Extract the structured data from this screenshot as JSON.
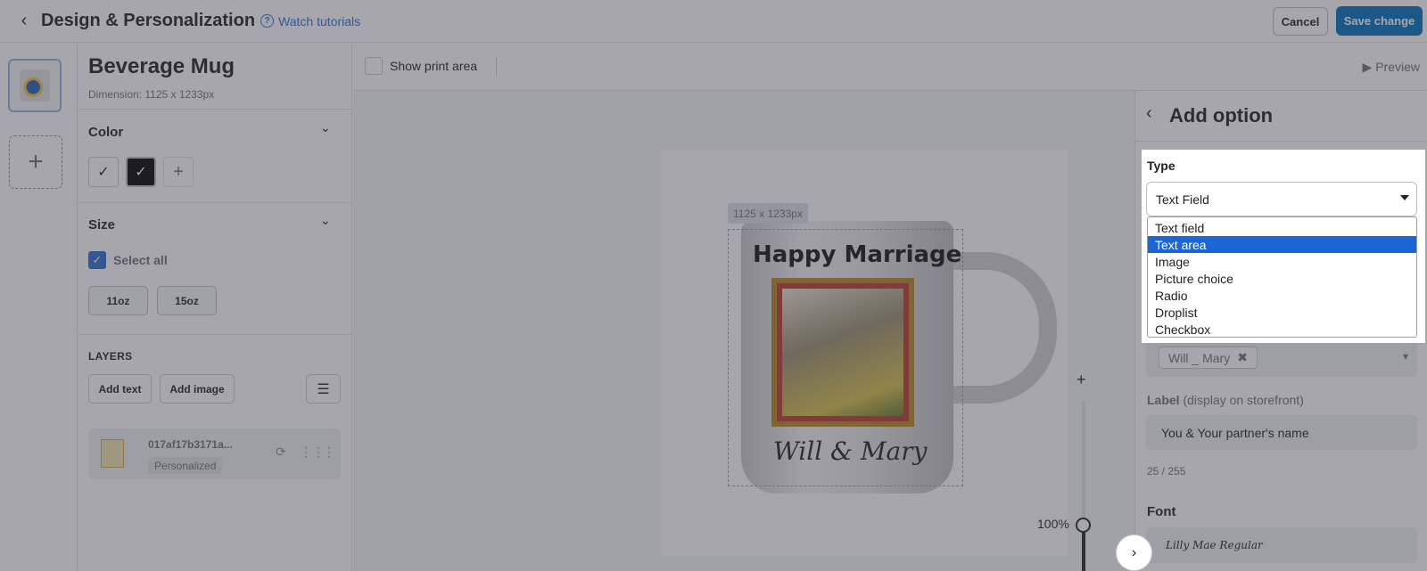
{
  "header": {
    "title": "Design & Personalization",
    "tutorial_link": "Watch tutorials",
    "cancel_label": "Cancel",
    "save_label": "Save change"
  },
  "product": {
    "name": "Beverage Mug",
    "dimension": "Dimension: 1125 x 1233px"
  },
  "color_section": {
    "title": "Color",
    "swatches": [
      {
        "color": "#ffffff",
        "selected": true
      },
      {
        "color": "#000000",
        "selected": true
      }
    ]
  },
  "size_section": {
    "title": "Size",
    "select_all_label": "Select all",
    "select_all_checked": true,
    "sizes": [
      "11oz",
      "15oz"
    ]
  },
  "layers": {
    "title": "LAYERS",
    "add_text_label": "Add text",
    "add_image_label": "Add image",
    "items": [
      {
        "name": "017af17b3171a...",
        "badge": "Personalized"
      }
    ]
  },
  "toolbar": {
    "show_print_area_label": "Show print area",
    "show_print_area_checked": false,
    "preview_label": "Preview"
  },
  "canvas": {
    "dimension_tag": "1125 x 1233px",
    "mug_title": "Happy Marriage",
    "mug_signature": "Will & Mary",
    "zoom_level": "100%"
  },
  "add_option": {
    "title": "Add option",
    "type_label": "Type",
    "type_selected": "Text Field",
    "type_options": [
      "Text field",
      "Text area",
      "Image",
      "Picture choice",
      "Radio",
      "Droplist",
      "Checkbox"
    ],
    "highlighted_option": "Text area",
    "tag_chip": "Will _ Mary",
    "label_title": "Label",
    "label_hint": "(display on storefront)",
    "label_value": "You & Your partner's name",
    "char_count": "25 / 255",
    "font_title": "Font",
    "font_value": "Lilly Mae Regular"
  },
  "colors": {
    "primary": "#006fbb",
    "link": "#2c6ecb",
    "highlight": "#1a66d4"
  }
}
